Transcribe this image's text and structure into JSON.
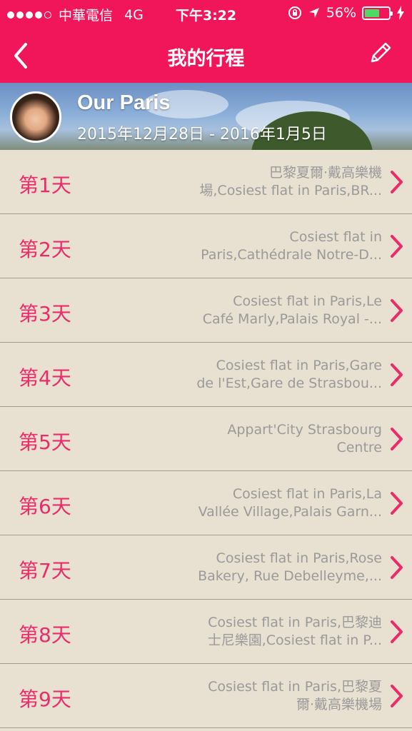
{
  "status_bar": {
    "carrier": "中華電信",
    "network": "4G",
    "time": "下午3:22",
    "battery": "56%"
  },
  "nav": {
    "title": "我的行程",
    "back_icon": "chevron-left-icon",
    "edit_icon": "pencil-icon"
  },
  "trip": {
    "name": "Our Paris",
    "dates": "2015年12月28日 - 2016年1月5日"
  },
  "days": [
    {
      "label": "第1天",
      "places_line1": "巴黎夏爾·戴高樂機",
      "places_line2": "場,Cosiest flat in Paris,BR..."
    },
    {
      "label": "第2天",
      "places_line1": "Cosiest flat in",
      "places_line2": "Paris,Cathédrale Notre-D..."
    },
    {
      "label": "第3天",
      "places_line1": "Cosiest flat in Paris,Le",
      "places_line2": "Café Marly,Palais Royal -..."
    },
    {
      "label": "第4天",
      "places_line1": "Cosiest flat in Paris,Gare",
      "places_line2": "de l'Est,Gare de Strasbou..."
    },
    {
      "label": "第5天",
      "places_line1": "Appart'City Strasbourg",
      "places_line2": "Centre"
    },
    {
      "label": "第6天",
      "places_line1": "Cosiest flat in Paris,La",
      "places_line2": "Vallée Village,Palais Garn..."
    },
    {
      "label": "第7天",
      "places_line1": "Cosiest flat in Paris,Rose",
      "places_line2": "Bakery, Rue Debelleyme,..."
    },
    {
      "label": "第8天",
      "places_line1": "Cosiest flat in Paris,巴黎迪",
      "places_line2": "士尼樂園,Cosiest flat in P..."
    },
    {
      "label": "第9天",
      "places_line1": "Cosiest flat in Paris,巴黎夏",
      "places_line2": "爾·戴高樂機場"
    }
  ],
  "colors": {
    "accent": "#f1155a",
    "row_background": "#e8e0d0",
    "day_label": "#ea2c6b",
    "places_text": "#9a9a9a"
  }
}
